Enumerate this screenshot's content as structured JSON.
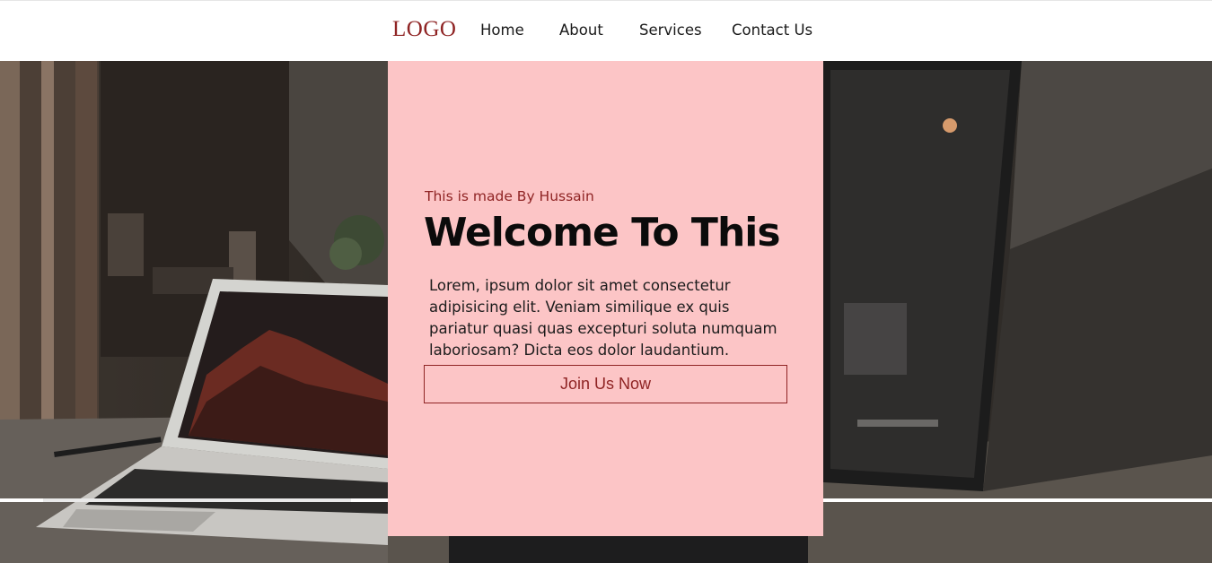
{
  "navbar": {
    "logo": "LOGO",
    "links": [
      "Home",
      "About",
      "Services",
      "Contact Us"
    ]
  },
  "hero": {
    "background_image": "desk-with-laptop-and-monitor-photo",
    "card": {
      "eyebrow": "This is made By Hussain",
      "title": "Welcome To This",
      "body": "Lorem, ipsum dolor sit amet consectetur adipisicing elit. Veniam similique ex quis pariatur quasi quas excepturi soluta numquam laboriosam? Dicta eos dolor laudantium.",
      "button_label": "Join Us Now"
    }
  },
  "colors": {
    "accent": "#8f2424",
    "card_background": "#fcc5c6",
    "nav_background": "#ffffff",
    "title_text": "#0b0b0b"
  }
}
